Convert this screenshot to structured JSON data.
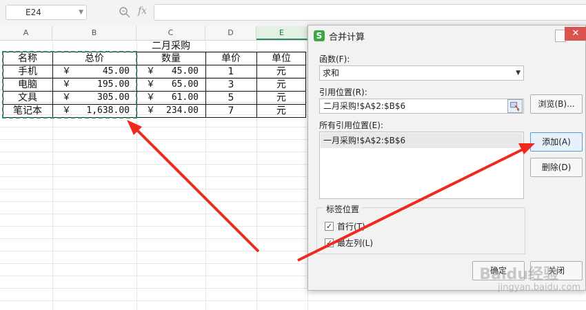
{
  "formula_bar": {
    "cell_ref": "E24",
    "fx_label": "fx",
    "formula": ""
  },
  "columns": [
    "A",
    "B",
    "C",
    "D",
    "E"
  ],
  "active_column": "E",
  "sheet": {
    "title": "二月采购",
    "headers": [
      "名称",
      "总价",
      "数量",
      "单价",
      "单位"
    ],
    "currency_symbol": "￥",
    "rows": [
      {
        "name": "手机",
        "total": "45.00",
        "qty": "45.00",
        "price": "1",
        "unit": "元"
      },
      {
        "name": "电脑",
        "total": "195.00",
        "qty": "65.00",
        "price": "3",
        "unit": "元"
      },
      {
        "name": "文具",
        "total": "305.00",
        "qty": "61.00",
        "price": "5",
        "unit": "元"
      },
      {
        "name": "笔记本",
        "total": "1,638.00",
        "qty": "234.00",
        "price": "7",
        "unit": "元"
      }
    ]
  },
  "dialog": {
    "icon_letter": "S",
    "title": "合并计算",
    "close_glyph": "✕",
    "function_label": "函数(F):",
    "function_value": "求和",
    "reference_label": "引用位置(R):",
    "reference_value": "二月采购!$A$2:$B$6",
    "browse_button": "浏览(B)...",
    "all_references_label": "所有引用位置(E):",
    "all_references": [
      "一月采购!$A$2:$B$6"
    ],
    "add_button": "添加(A)",
    "delete_button": "删除(D)",
    "label_position_title": "标签位置",
    "first_row_label": "首行(T)",
    "first_row_checked": true,
    "left_column_label": "最左列(L)",
    "left_column_checked": true,
    "ok_button": "确定",
    "close_button": "关闭"
  },
  "watermark": {
    "brand": "Baidu经验",
    "url": "jingyan.baidu.com"
  },
  "colors": {
    "arrow": "#ee2a1f",
    "selection": "#2e8b57",
    "dialog_close": "#d9534f"
  }
}
